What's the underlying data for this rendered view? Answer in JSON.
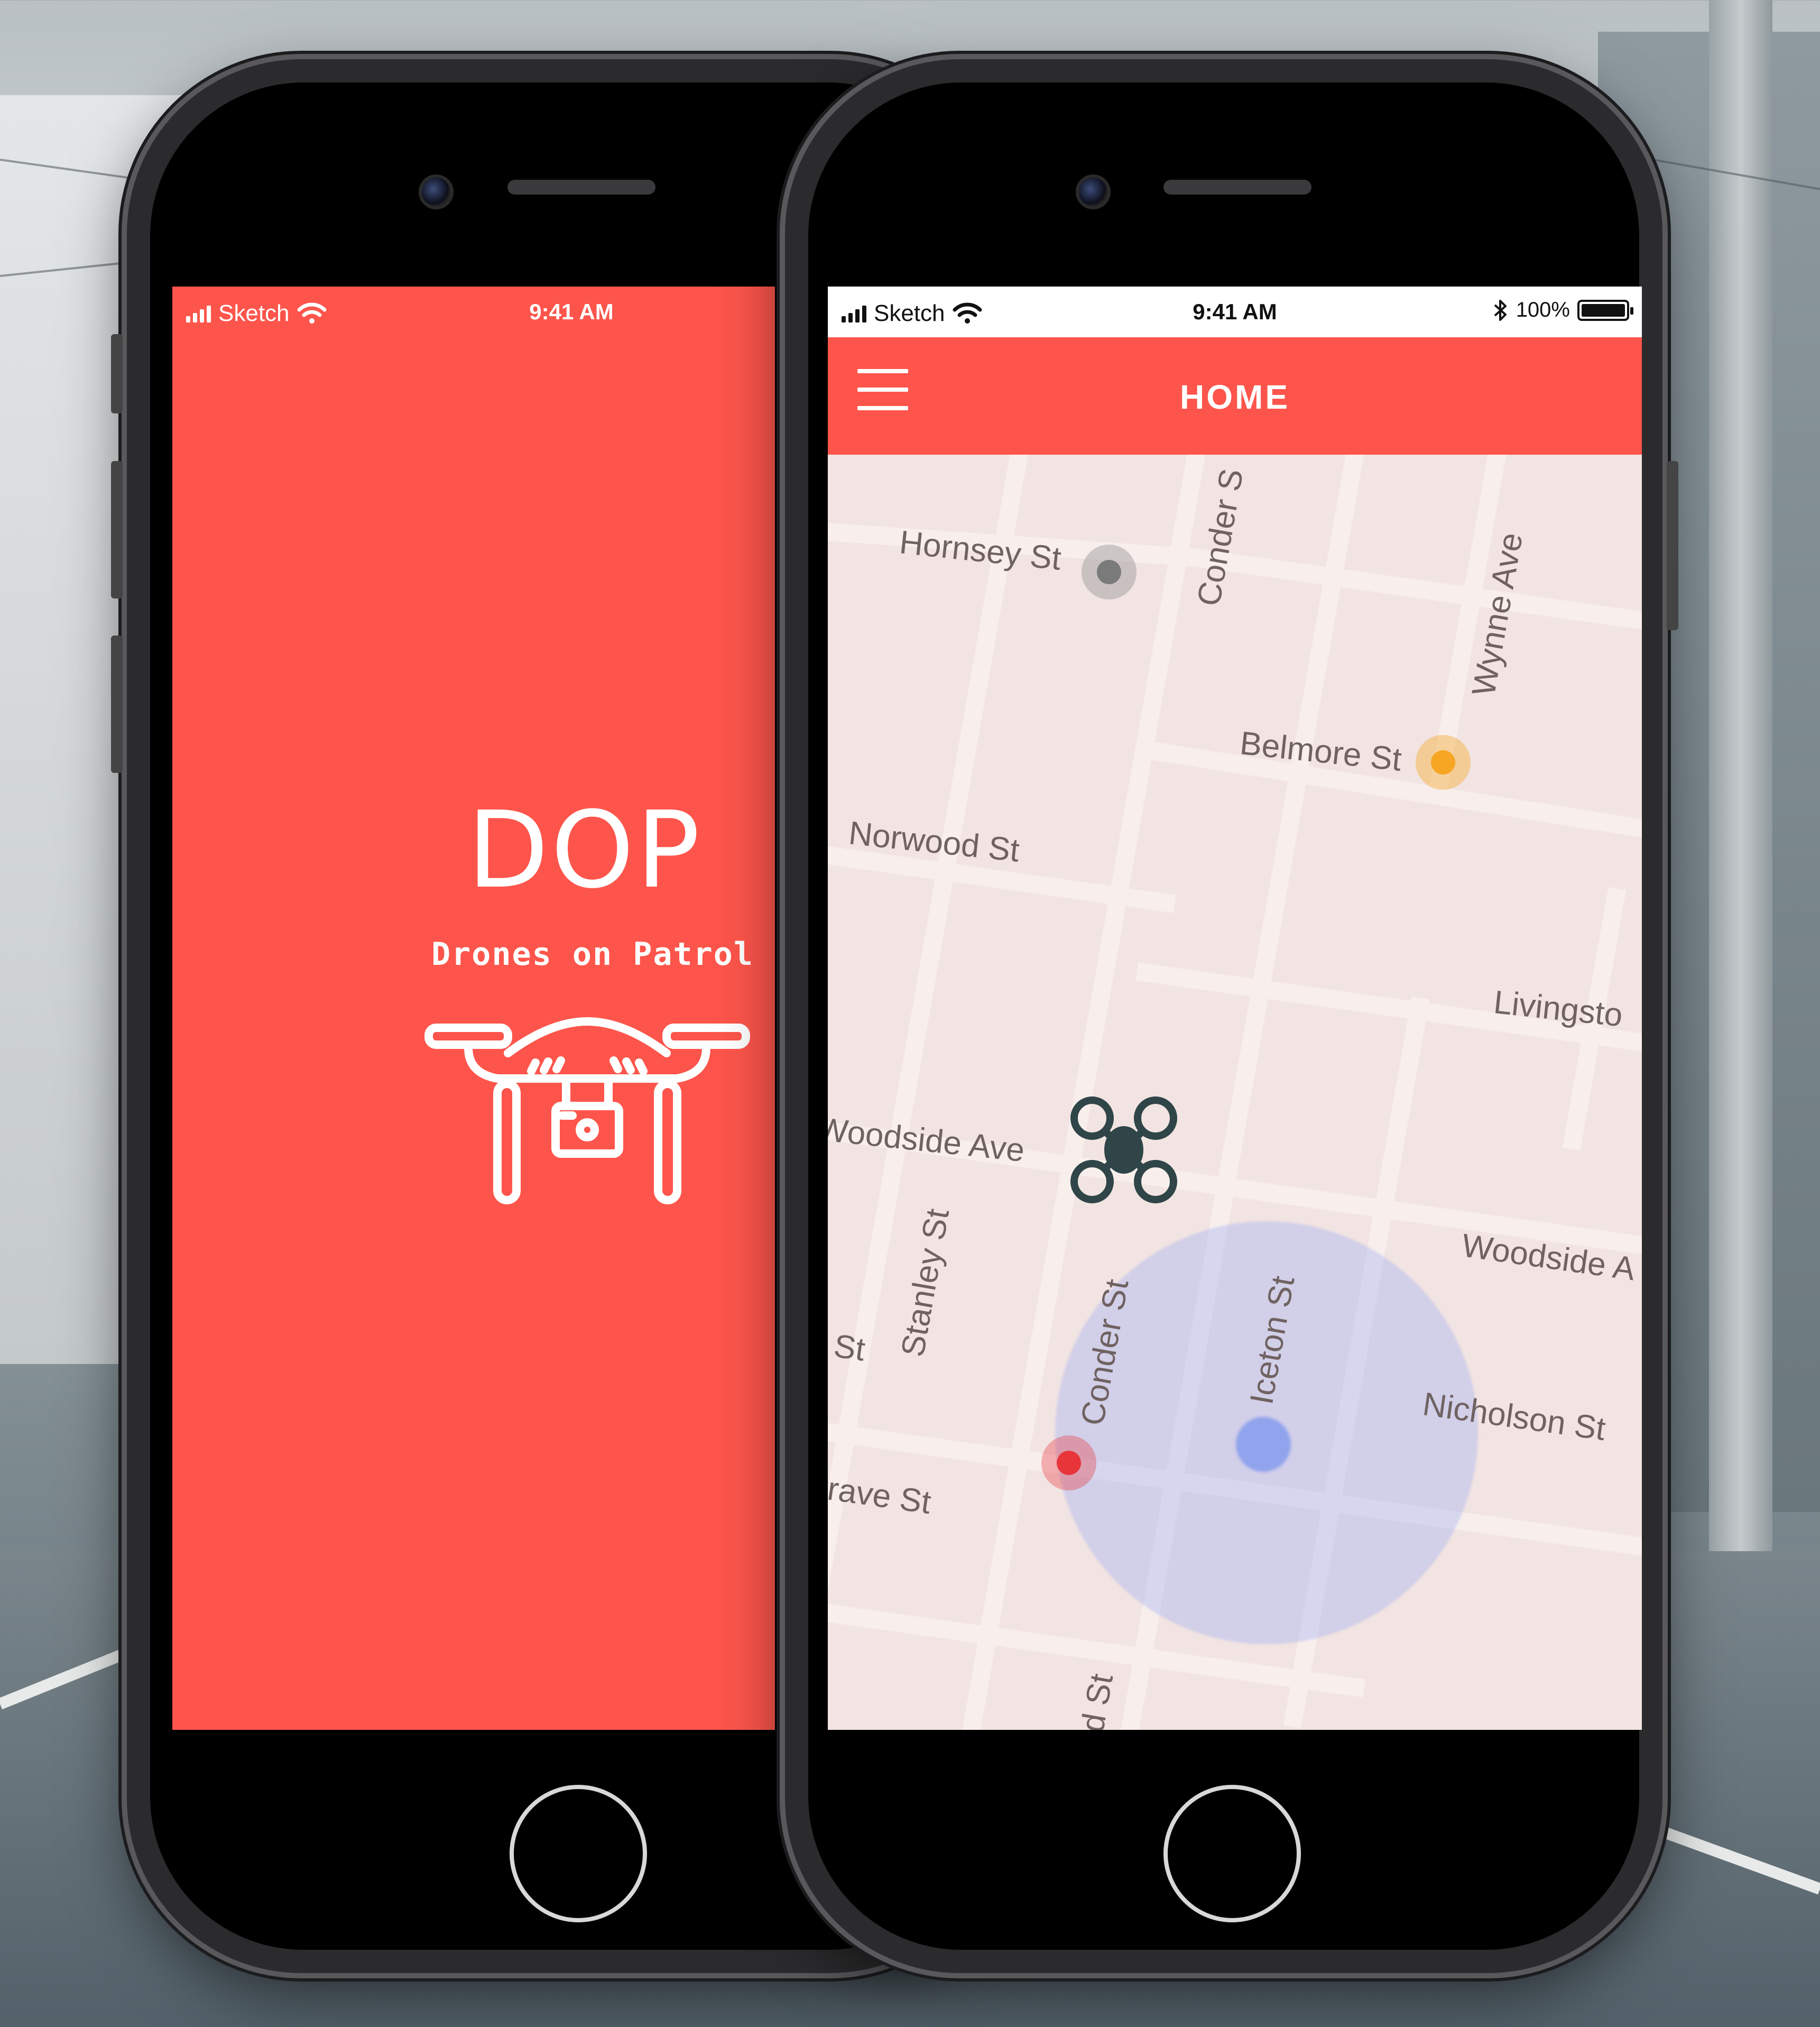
{
  "status_bar": {
    "carrier": "Sketch",
    "time": "9:41 AM",
    "battery": "100%"
  },
  "splash": {
    "title": "DOP",
    "subtitle": "Drones on Patrol",
    "background_color": "#fd554b",
    "illustration": "drone-with-camera-icon"
  },
  "home": {
    "app_bar_title": "HOME",
    "menu_icon": "hamburger-menu-icon",
    "accent_color": "#fd554b",
    "map": {
      "streets": [
        "Hornsey St",
        "Conder S",
        "Wynne Ave",
        "Belmore St",
        "Norwood St",
        "Livingsto",
        "Woodside Ave",
        "Stanley St",
        "Woodside A",
        "Conder St",
        "Iceton St",
        "St",
        "Nicholson St",
        "rave St",
        "d St"
      ],
      "markers": [
        {
          "name": "gray-marker",
          "color": "#7a7a7a"
        },
        {
          "name": "yellow-marker",
          "color": "#f6a623"
        },
        {
          "name": "red-marker",
          "color": "#e8353a"
        },
        {
          "name": "blue-marker",
          "color": "#5b7ff0"
        }
      ],
      "drone_icon": "quadcopter-icon",
      "zone_color": "#a6b2f4"
    }
  }
}
